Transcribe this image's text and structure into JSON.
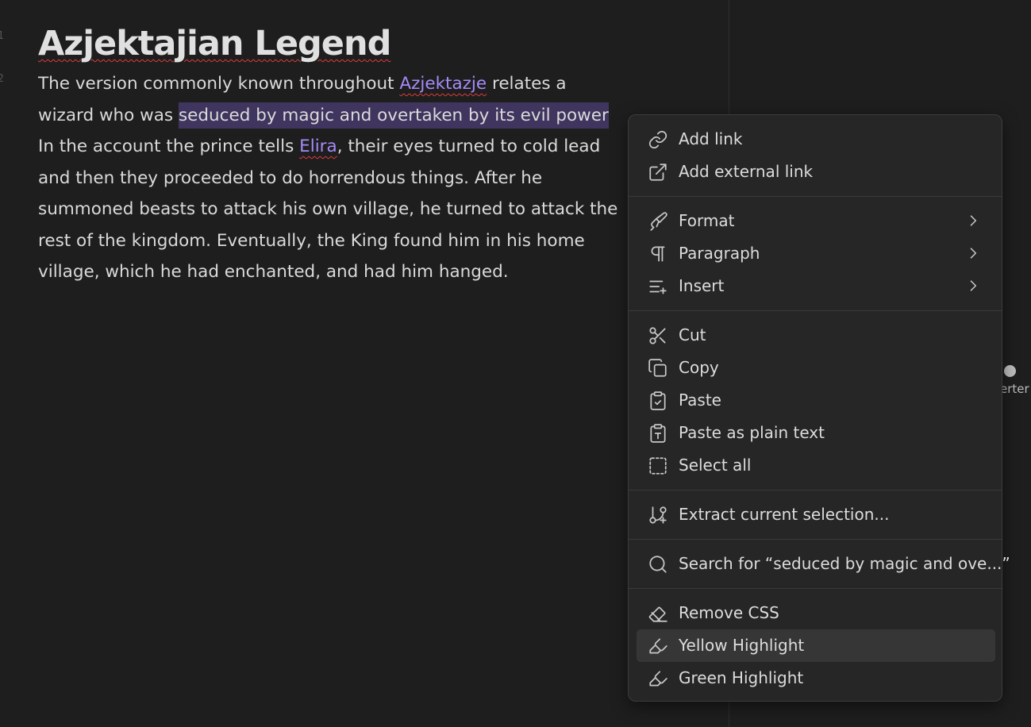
{
  "editor": {
    "line_numbers": [
      "1",
      "2"
    ],
    "title": "Azjektajian Legend",
    "paragraph": {
      "l1_pre": "The version commonly known throughout ",
      "l1_link": "Azjektazje",
      "l1_post": " relates a",
      "l2_pre": "wizard who was ",
      "l2_sel": "seduced by magic and overtaken by its evil power",
      "l3_pre": "In the account the prince tells ",
      "l3_link": "Elira",
      "l3_post": ", their eyes turned to cold lead",
      "l4": "and then they proceeded to do horrendous things. After he",
      "l5": "summoned beasts to attack his own village, he turned to attack the",
      "l6": "rest of the kingdom. Eventually, the King found him in his home",
      "l7": "village, which he had enchanted, and had him hanged."
    }
  },
  "graph": {
    "label": "erter T"
  },
  "menu": {
    "items": [
      {
        "label": "Add link",
        "icon": "link-icon"
      },
      {
        "label": "Add external link",
        "icon": "external-link-icon"
      },
      {
        "label": "Format",
        "icon": "paintbrush-icon"
      },
      {
        "label": "Paragraph",
        "icon": "pilcrow-icon"
      },
      {
        "label": "Insert",
        "icon": "list-plus-icon"
      },
      {
        "label": "Cut",
        "icon": "scissors-icon"
      },
      {
        "label": "Copy",
        "icon": "copy-icon"
      },
      {
        "label": "Paste",
        "icon": "clipboard-check-icon"
      },
      {
        "label": "Paste as plain text",
        "icon": "clipboard-text-icon"
      },
      {
        "label": "Select all",
        "icon": "select-all-icon"
      },
      {
        "label": "Extract current selection...",
        "icon": "git-branch-plus-icon"
      },
      {
        "label": "Search for “seduced by magic and ove...”",
        "icon": "search-icon"
      },
      {
        "label": "Remove CSS",
        "icon": "eraser-icon"
      },
      {
        "label": "Yellow Highlight",
        "icon": "highlighter-icon"
      },
      {
        "label": "Green Highlight",
        "icon": "highlighter-icon"
      }
    ]
  }
}
